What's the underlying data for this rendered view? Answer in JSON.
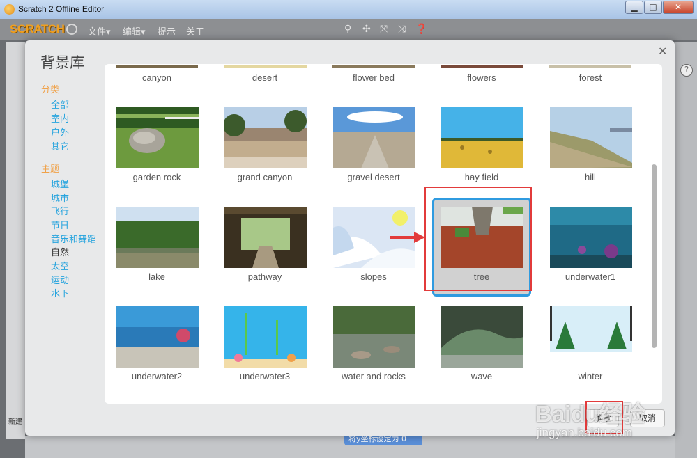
{
  "window": {
    "title": "Scratch 2 Offline Editor",
    "min": "▁",
    "max": "□",
    "close": "✕"
  },
  "menubar": {
    "logo": "SCRATCH",
    "items": [
      "文件▾",
      "编辑▾",
      "提示",
      "关于"
    ],
    "tool_icons": [
      "stamp-icon",
      "cut-icon",
      "grow-icon",
      "shrink-icon",
      "help-icon"
    ]
  },
  "dialog": {
    "title": "背景库",
    "close": "✕",
    "category_heading": "分类",
    "categories": [
      "全部",
      "室内",
      "户外",
      "其它"
    ],
    "theme_heading": "主题",
    "themes": [
      "城堡",
      "城市",
      "飞行",
      "节日",
      "音乐和舞蹈",
      "自然",
      "太空",
      "运动",
      "水下"
    ],
    "selected_theme": "自然",
    "partial_row": [
      "canyon",
      "desert",
      "flower bed",
      "flowers",
      "forest"
    ],
    "rows": [
      [
        "garden rock",
        "grand canyon",
        "gravel desert",
        "hay field",
        "hill"
      ],
      [
        "lake",
        "pathway",
        "slopes",
        "tree",
        "underwater1"
      ],
      [
        "underwater2",
        "underwater3",
        "water and rocks",
        "wave",
        "winter"
      ]
    ],
    "selected_item": "tree",
    "ok_label": "确定",
    "cancel_label": "取消"
  },
  "background": {
    "new_label": "新建",
    "block_label": "将y坐标设定为 0",
    "help": "?"
  },
  "watermark": {
    "main": "Baidu经验",
    "sub": "jingyan.baidu.com"
  }
}
